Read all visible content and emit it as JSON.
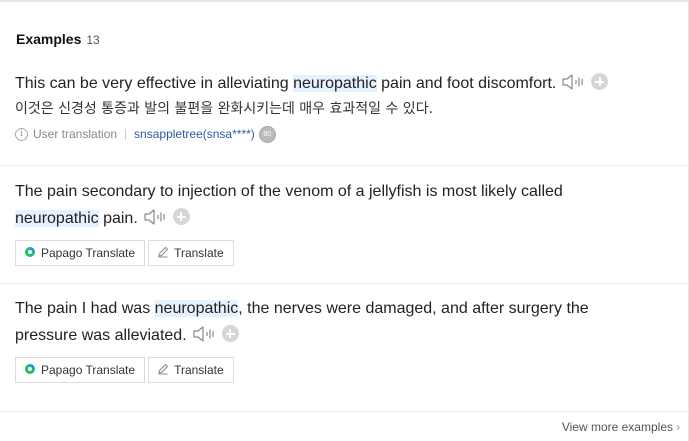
{
  "header": {
    "title": "Examples",
    "count": "13"
  },
  "examples": [
    {
      "parts": [
        "This can be very effective in alleviating ",
        "neuropathic",
        " pain and foot discomfort."
      ],
      "translation": "이것은 신경성 통증과 발의 불편을 완화시키는데 매우 효과적일 수 있다.",
      "meta": {
        "label": "User translation",
        "user": "snsappletree(snsa****)",
        "badge": "80"
      }
    },
    {
      "line1": "The pain secondary to injection of the venom of a jellyfish is most likely called",
      "line2_parts": [
        "neuropathic",
        " pain."
      ],
      "buttons": {
        "papago": "Papago Translate",
        "translate": "Translate"
      }
    },
    {
      "line1_parts": [
        "The pain I had was ",
        "neuropathic",
        ", the nerves were damaged, and after surgery the"
      ],
      "line2": "pressure was alleviated.",
      "buttons": {
        "papago": "Papago Translate",
        "translate": "Translate"
      }
    }
  ],
  "footer": {
    "more_label": "View more examples",
    "chevron": "›"
  },
  "icons": {
    "speaker": "speaker-icon",
    "add": "plus-circle-icon",
    "info": "info-icon",
    "papago": "papago-logo-icon",
    "pencil": "pencil-icon"
  },
  "colors": {
    "highlight": "#e5f1ff",
    "user_link": "#2b5aa6",
    "papago_green": "#1fc06b",
    "papago_blue": "#2c8cf0"
  }
}
